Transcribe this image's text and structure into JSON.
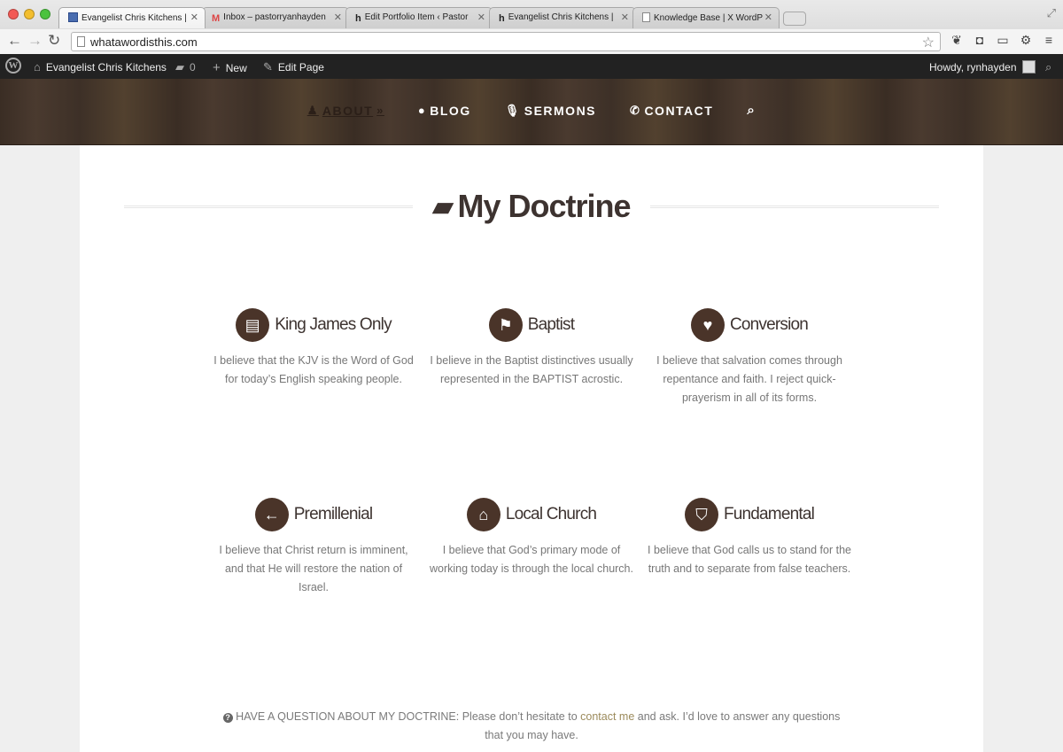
{
  "browser": {
    "tabs": [
      {
        "title": "Evangelist Chris Kitchens |",
        "active": true,
        "icon": "grid-favicon-icon"
      },
      {
        "title": "Inbox – pastorryanhayden",
        "active": false,
        "icon": "gmail-icon"
      },
      {
        "title": "Edit Portfolio Item ‹ Pastor",
        "active": false,
        "icon": "h-favicon-icon"
      },
      {
        "title": "Evangelist Chris Kitchens |",
        "active": false,
        "icon": "h-favicon-icon"
      },
      {
        "title": "Knowledge Base | X WordP",
        "active": false,
        "icon": "page-icon"
      }
    ],
    "url": "whatawordisthis.com"
  },
  "adminbar": {
    "site_name": "Evangelist Chris Kitchens",
    "comments_count": "0",
    "new_label": "New",
    "edit_label": "Edit Page",
    "howdy": "Howdy, rynhayden"
  },
  "nav": {
    "items": [
      {
        "label": "ABOUT",
        "icon": "user-icon",
        "current": true
      },
      {
        "label": "BLOG",
        "icon": "comment-icon",
        "current": false
      },
      {
        "label": "SERMONS",
        "icon": "microphone-icon",
        "current": false
      },
      {
        "label": "CONTACT",
        "icon": "phone-icon",
        "current": false
      }
    ],
    "search_icon": "search-icon"
  },
  "page": {
    "title": "My Doctrine"
  },
  "features": [
    {
      "title": "King James Only",
      "icon": "book-icon",
      "text": "I believe that the KJV is the Word of God for today’s English speaking people."
    },
    {
      "title": "Baptist",
      "icon": "flag-icon",
      "text": "I believe in the Baptist distinctives usually represented in the BAPTIST acrostic."
    },
    {
      "title": "Conversion",
      "icon": "heart-icon",
      "text": "I believe that salvation comes through repentance and faith. I reject quick-prayerism in all of its forms."
    },
    {
      "title": "Premillenial",
      "icon": "arrow-left-icon",
      "text": "I believe that Christ return is imminent, and that He will restore the nation of Israel."
    },
    {
      "title": "Local Church",
      "icon": "home-icon",
      "text": "I believe that God’s primary mode of working today is through the local church."
    },
    {
      "title": "Fundamental",
      "icon": "shield-icon",
      "text": "I believe that God calls us to stand for the truth and to separate from false teachers."
    }
  ],
  "question": {
    "prefix": "HAVE A QUESTION ABOUT MY DOCTRINE: Please don’t hesitate to ",
    "link": "contact me",
    "suffix": " and ask. I’d love to answer any questions that you may have."
  },
  "colors": {
    "accent": "#4a3429",
    "link": "#9c8b5c",
    "heading": "#3d3330"
  }
}
